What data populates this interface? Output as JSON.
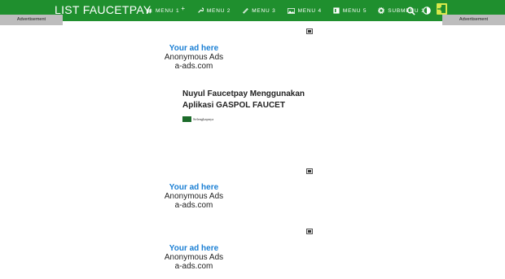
{
  "header": {
    "brand": "LIST FAUCETPAY",
    "menu": [
      {
        "label": "MENU 1",
        "icon": "hash-icon",
        "has_plus": true
      },
      {
        "label": "MENU 2",
        "icon": "wrench-icon",
        "has_plus": false
      },
      {
        "label": "MENU 3",
        "icon": "pencil-icon",
        "has_plus": false
      },
      {
        "label": "MENU 4",
        "icon": "image-icon",
        "has_plus": false
      },
      {
        "label": "MENU 5",
        "icon": "book-icon",
        "has_plus": false
      },
      {
        "label": "SUBMENU 1",
        "icon": "gear-icon",
        "has_plus": true
      }
    ],
    "plus": "+",
    "colors": {
      "bar": "#1f8f2e",
      "exit": "#d7e84a"
    }
  },
  "side_ads": {
    "left": "Advertisement",
    "right": "Advertisement"
  },
  "ads": [
    {
      "title": "Your ad here",
      "name": "Anonymous Ads",
      "url": "a-ads.com"
    },
    {
      "title": "Your ad here",
      "name": "Anonymous Ads",
      "url": "a-ads.com"
    },
    {
      "title": "Your ad here",
      "name": "Anonymous Ads",
      "url": "a-ads.com"
    }
  ],
  "post": {
    "title": "Nuyul Faucetpay Menggunakan Aplikasi GASPOL FAUCET",
    "meta": "Selengkapnya"
  }
}
